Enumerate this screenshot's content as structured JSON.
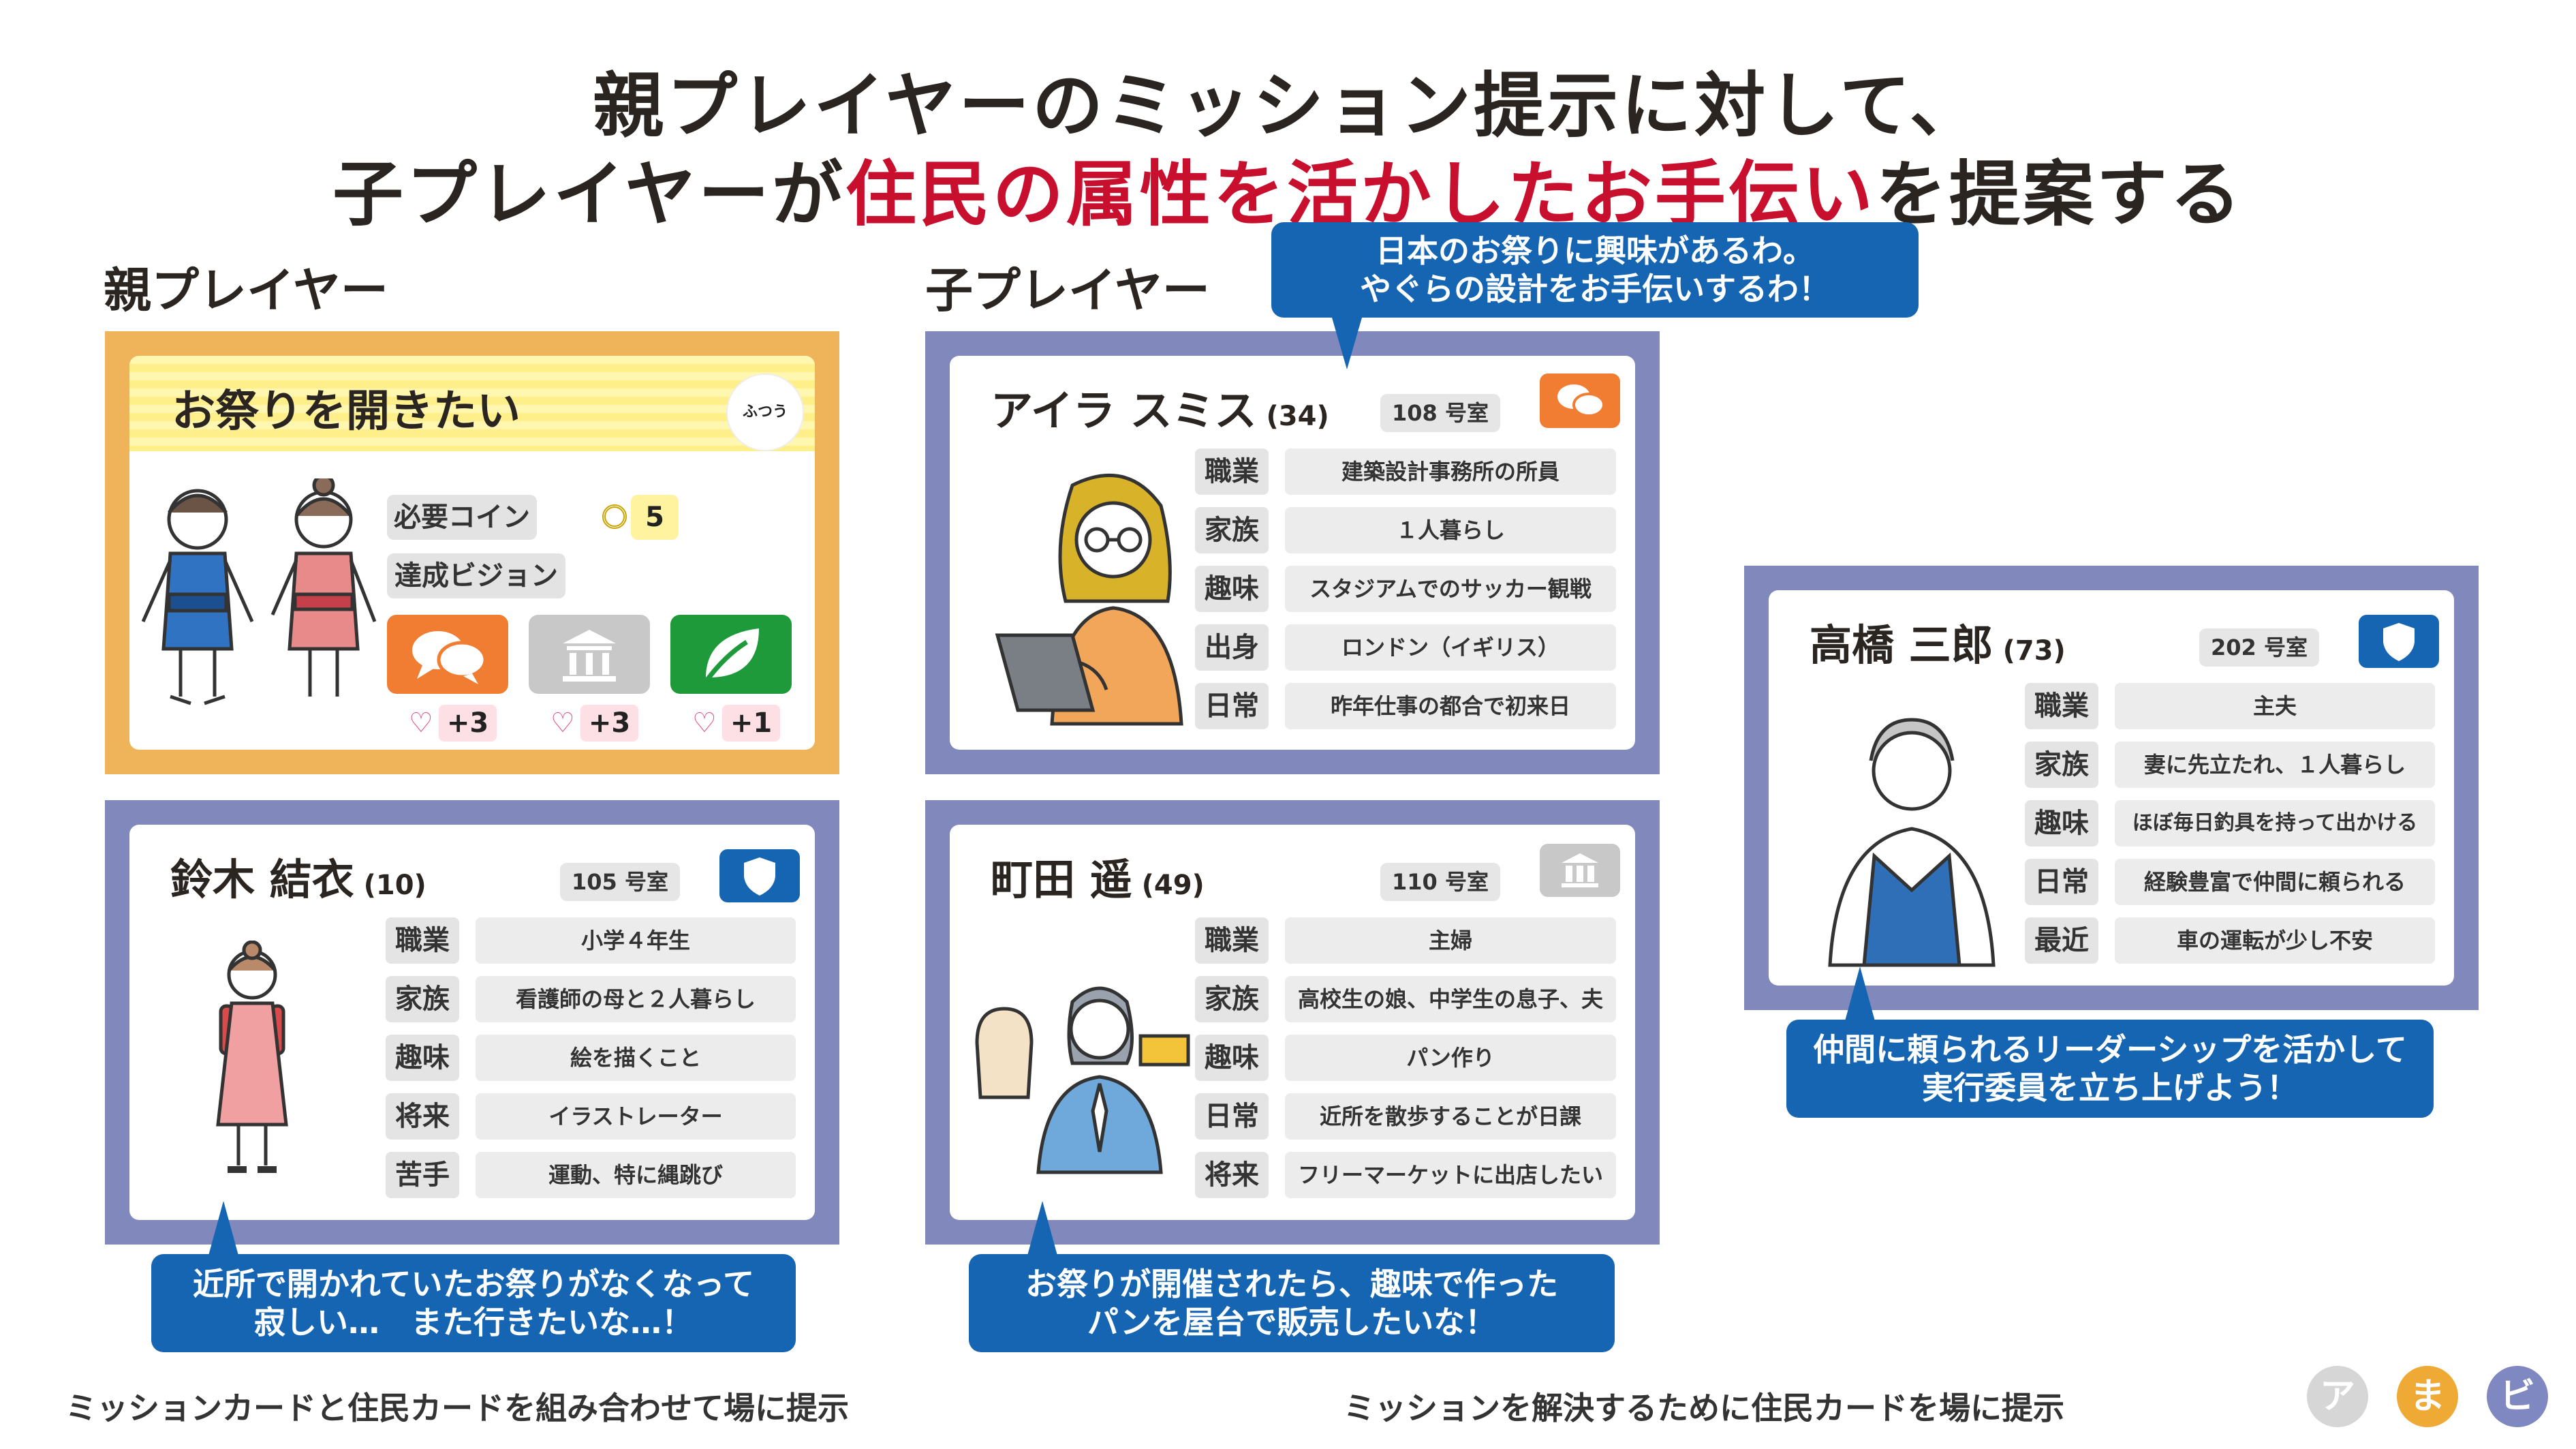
{
  "title": {
    "line1": "親プレイヤーのミッション提示に対して、",
    "line2_pre": "子プレイヤーが",
    "line2_red": "住民の属性を活かしたお手伝い",
    "line2_post": "を提案する"
  },
  "sections": {
    "parent": "親プレイヤー",
    "child": "子プレイヤー"
  },
  "mission_card": {
    "title": "お祭りを開きたい",
    "difficulty": "ふつう",
    "required_coin_label": "必要コイン",
    "coin_value": "5",
    "vision_label": "達成ビジョン",
    "rewards": [
      "+3",
      "+3",
      "+1"
    ]
  },
  "residents": {
    "suzuki": {
      "name": "鈴木 結衣",
      "age": "(10)",
      "room": "105 号室",
      "attrs": [
        {
          "label": "職業",
          "value": "小学４年生"
        },
        {
          "label": "家族",
          "value": "看護師の母と２人暮らし"
        },
        {
          "label": "趣味",
          "value": "絵を描くこと"
        },
        {
          "label": "将来",
          "value": "イラストレーター"
        },
        {
          "label": "苦手",
          "value": "運動、特に縄跳び"
        }
      ]
    },
    "aira": {
      "name": "アイラ スミス",
      "age": "(34)",
      "room": "108 号室",
      "attrs": [
        {
          "label": "職業",
          "value": "建築設計事務所の所員"
        },
        {
          "label": "家族",
          "value": "１人暮らし"
        },
        {
          "label": "趣味",
          "value": "スタジアムでのサッカー観戦"
        },
        {
          "label": "出身",
          "value": "ロンドン（イギリス）"
        },
        {
          "label": "日常",
          "value": "昨年仕事の都合で初来日"
        }
      ]
    },
    "machida": {
      "name": "町田 遥",
      "age": "(49)",
      "room": "110 号室",
      "attrs": [
        {
          "label": "職業",
          "value": "主婦"
        },
        {
          "label": "家族",
          "value": "高校生の娘、中学生の息子、夫"
        },
        {
          "label": "趣味",
          "value": "パン作り"
        },
        {
          "label": "日常",
          "value": "近所を散歩することが日課"
        },
        {
          "label": "将来",
          "value": "フリーマーケットに出店したい"
        }
      ]
    },
    "takahashi": {
      "name": "高橋 三郎",
      "age": "(73)",
      "room": "202 号室",
      "attrs": [
        {
          "label": "職業",
          "value": "主夫"
        },
        {
          "label": "家族",
          "value": "妻に先立たれ、１人暮らし"
        },
        {
          "label": "趣味",
          "value": "ほぼ毎日釣具を持って出かける"
        },
        {
          "label": "日常",
          "value": "経験豊富で仲間に頼られる"
        },
        {
          "label": "最近",
          "value": "車の運転が少し不安"
        }
      ]
    }
  },
  "bubbles": {
    "aira": [
      "日本のお祭りに興味があるわ。",
      "やぐらの設計をお手伝いするわ！"
    ],
    "suzuki": [
      "近所で開かれていたお祭りがなくなって",
      "寂しい…　また行きたいな…！"
    ],
    "machida": [
      "お祭りが開催されたら、趣味で作った",
      "パンを屋台で販売したいな！"
    ],
    "takahashi": [
      "仲間に頼られるリーダーシップを活かして",
      "実行委員を立ち上げよう！"
    ]
  },
  "captions": {
    "left": "ミッションカードと住民カードを組み合わせて場に提示",
    "right": "ミッションを解決するために住民カードを場に提示"
  },
  "logo": [
    "ア",
    "ま",
    "ビ"
  ],
  "colors": {
    "mission_frame": "#efb45a",
    "resident_frame": "#8088bc",
    "bubble": "#1565b3",
    "accent_red": "#c8102e",
    "vision_orange": "#f07d32",
    "vision_gray": "#c8c8c8",
    "vision_green": "#1e9a3a",
    "shield_blue": "#1565b3"
  },
  "icons": {
    "vision": [
      "speech-bubbles-icon",
      "government-building-icon",
      "leaf-icon"
    ],
    "badges": {
      "suzuki": "shield-icon",
      "aira": "speech-bubbles-icon",
      "machida": "government-building-icon",
      "takahashi": "shield-icon"
    }
  }
}
